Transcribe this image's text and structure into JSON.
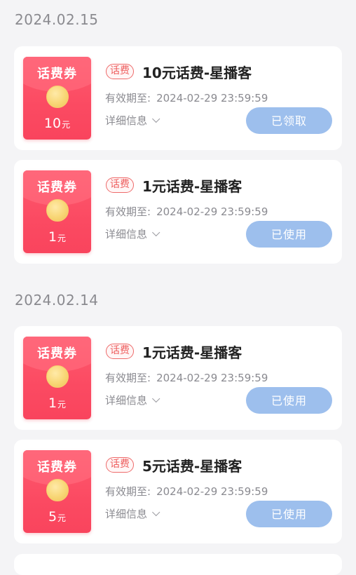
{
  "groups": [
    {
      "date": "2024.02.15",
      "coupons": [
        {
          "voucher_title": "话费券",
          "amount": "10",
          "unit": "元",
          "tag": "话费",
          "name": "10元话费-星播客",
          "expiry_label": "有效期至:",
          "expiry": "2024-02-29 23:59:59",
          "detail": "详细信息",
          "status": "已领取"
        },
        {
          "voucher_title": "话费券",
          "amount": "1",
          "unit": "元",
          "tag": "话费",
          "name": "1元话费-星播客",
          "expiry_label": "有效期至:",
          "expiry": "2024-02-29 23:59:59",
          "detail": "详细信息",
          "status": "已使用"
        }
      ]
    },
    {
      "date": "2024.02.14",
      "coupons": [
        {
          "voucher_title": "话费券",
          "amount": "1",
          "unit": "元",
          "tag": "话费",
          "name": "1元话费-星播客",
          "expiry_label": "有效期至:",
          "expiry": "2024-02-29 23:59:59",
          "detail": "详细信息",
          "status": "已使用"
        },
        {
          "voucher_title": "话费券",
          "amount": "5",
          "unit": "元",
          "tag": "话费",
          "name": "5元话费-星播客",
          "expiry_label": "有效期至:",
          "expiry": "2024-02-29 23:59:59",
          "detail": "详细信息",
          "status": "已使用"
        }
      ]
    }
  ],
  "colors": {
    "voucher_red": "#fb4a62",
    "status_button": "#9dbfed",
    "tag_red": "#ee5f5f",
    "page_bg": "#f4f4f6"
  },
  "icons": {
    "coin": "coin-icon",
    "chevron": "chevron-down-icon"
  }
}
